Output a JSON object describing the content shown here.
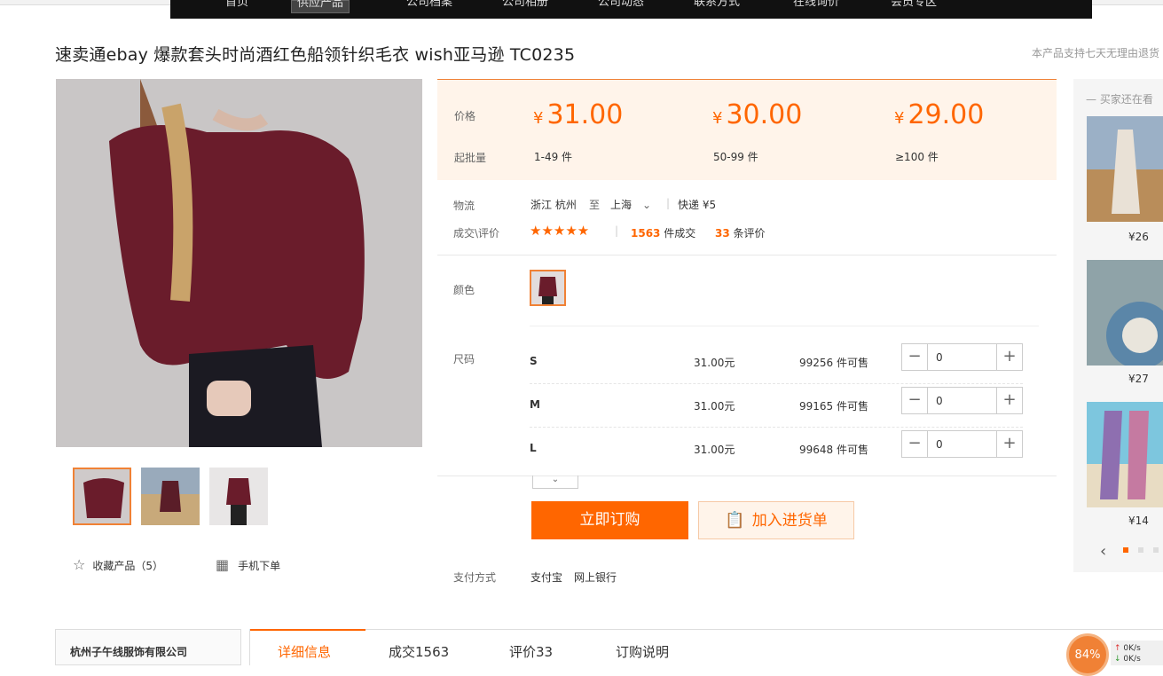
{
  "nav": {
    "items": [
      "首页",
      "供应产品",
      "公司档案",
      "公司相册",
      "公司动态",
      "联系方式",
      "在线询价",
      "会员专区"
    ]
  },
  "product": {
    "title": "速卖通ebay 爆款套头时尚酒红色船领针织毛衣 wish亚马逊 TC0235",
    "return_note": "本产品支持七天无理由退货"
  },
  "actions": {
    "favorite_label": "收藏产品（5）",
    "mobile_label": "手机下单"
  },
  "pricing": {
    "price_label": "价格",
    "moq_label": "起批量",
    "currency": "¥",
    "tiers": [
      {
        "price": "31.00",
        "qty": "1-49 件"
      },
      {
        "price": "30.00",
        "qty": "50-99 件"
      },
      {
        "price": "29.00",
        "qty": "≥100 件"
      }
    ]
  },
  "logistics": {
    "label": "物流",
    "from": "浙江 杭州",
    "to_word": "至",
    "to": "上海",
    "shipping": "快递 ¥5"
  },
  "reviews": {
    "label": "成交\\评价",
    "stars": "★★★★★",
    "deals_count": "1563",
    "deals_suffix": "件成交",
    "review_count": "33",
    "review_suffix": "条评价"
  },
  "color": {
    "label": "颜色"
  },
  "sizes": {
    "label": "尺码",
    "rows": [
      {
        "name": "S",
        "price": "31.00元",
        "stock": "99256 件可售",
        "qty": "0"
      },
      {
        "name": "M",
        "price": "31.00元",
        "stock": "99165 件可售",
        "qty": "0"
      },
      {
        "name": "L",
        "price": "31.00元",
        "stock": "99648 件可售",
        "qty": "0"
      }
    ]
  },
  "buttons": {
    "buy": "立即订购",
    "add_cart": "加入进货单"
  },
  "payment": {
    "label": "支付方式",
    "alipay": "支付宝",
    "bank": "网上银行"
  },
  "sidebar": {
    "heading": "买家还在看",
    "items": [
      {
        "price": "¥26"
      },
      {
        "price": "¥27"
      },
      {
        "price": "¥14"
      }
    ]
  },
  "bottom": {
    "company": "杭州子午线服饰有限公司",
    "tabs": [
      "详细信息",
      "成交1563",
      "评价33",
      "订购说明"
    ]
  },
  "widget": {
    "percent": "84%",
    "up": "0K/s",
    "down": "0K/s"
  }
}
